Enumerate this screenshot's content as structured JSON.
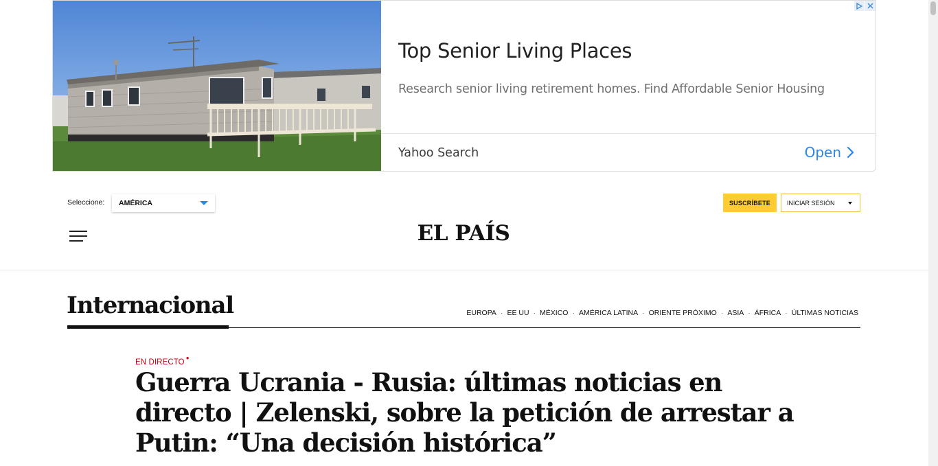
{
  "ad": {
    "title": "Top Senior Living Places",
    "description": "Research senior living retirement homes. Find Affordable Senior Housing",
    "source": "Yahoo Search",
    "cta": "Open",
    "image_icon": "mobile-home-photo",
    "accent_color": "#2c85e8"
  },
  "header": {
    "select_label": "Seleccione:",
    "edition": "AMÉRICA",
    "subscribe_label": "SUSCRÍBETE",
    "login_label": "INICIAR SESIÓN",
    "logo": "EL PAÍS",
    "menu_icon": "hamburger-menu-icon",
    "subscribe_color": "#ffcc33"
  },
  "section": {
    "title": "Internacional",
    "nav": [
      "EUROPA",
      "EE UU",
      "MÉXICO",
      "AMÉRICA LATINA",
      "ORIENTE PRÓXIMO",
      "ASIA",
      "ÁFRICA",
      "ÚLTIMAS NOTICIAS"
    ]
  },
  "article": {
    "kicker": "EN DIRECTO",
    "kicker_mark": "●",
    "kicker_color": "#c40414",
    "headline": "Guerra Ucrania - Rusia: últimas noticias en directo | Zelenski, sobre la petición de arrestar a Putin: “Una decisión histórica”"
  }
}
